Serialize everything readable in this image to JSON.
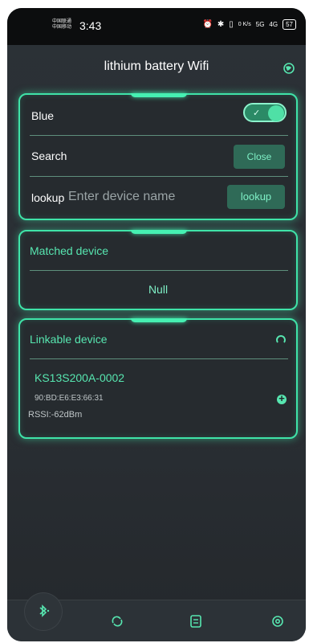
{
  "status_bar": {
    "carrier_1": "中国联通",
    "carrier_2": "中国移动",
    "time": "3:43",
    "speed": "0 K/s",
    "signal_1": "5G",
    "signal_2": "4G",
    "battery": "57"
  },
  "header": {
    "title": "lithium battery Wifi"
  },
  "control_card": {
    "blue_label": "Blue",
    "blue_toggle_on": true,
    "search_label": "Search",
    "close_button": "Close",
    "lookup_label": "lookup",
    "lookup_placeholder": "Enter device name",
    "lookup_button": "lookup"
  },
  "matched_card": {
    "title": "Matched device",
    "empty_text": "Null"
  },
  "linkable_card": {
    "title": "Linkable device",
    "devices": [
      {
        "name": "KS13S200A-0002",
        "mac": "90:BD:E6:E3:66:31",
        "rssi": "RSSI:-62dBm"
      }
    ]
  },
  "bottom_nav": {
    "items": [
      "bluetooth-icon",
      "refresh-icon",
      "document-icon",
      "settings-icon"
    ],
    "active": "bluetooth-icon"
  },
  "colors": {
    "accent": "#3fe3a8",
    "background": "#2a2f34",
    "button_bg": "#2f6a57"
  }
}
